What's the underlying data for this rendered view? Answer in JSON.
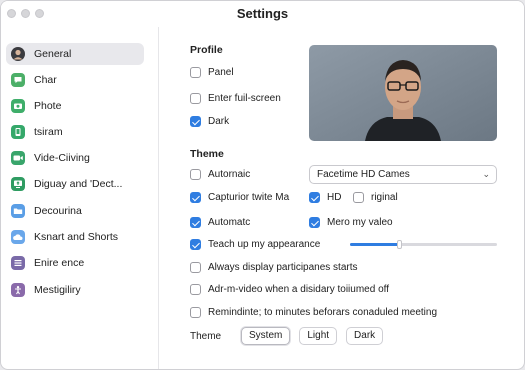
{
  "window": {
    "title": "Settings"
  },
  "sidebar": {
    "items": [
      {
        "label": "General",
        "icon": "avatar-icon",
        "color": "#ffffff"
      },
      {
        "label": "Char",
        "icon": "chat-icon",
        "color": "#4caf68"
      },
      {
        "label": "Phote",
        "icon": "camera-icon",
        "color": "#3fae6a"
      },
      {
        "label": "tsiram",
        "icon": "phone-icon",
        "color": "#35a86a"
      },
      {
        "label": "Vide-Ciiving",
        "icon": "video-icon",
        "color": "#39a56b"
      },
      {
        "label": "Diguay and 'Dect...",
        "icon": "share-screen-icon",
        "color": "#2f9c62"
      },
      {
        "label": "Decourina",
        "icon": "folder-icon",
        "color": "#5a9ee6"
      },
      {
        "label": "Ksnart and Shorts",
        "icon": "cloud-icon",
        "color": "#6aa7ea"
      },
      {
        "label": "Enire ence",
        "icon": "list-icon",
        "color": "#7a6aa8"
      },
      {
        "label": "Mestigiliry",
        "icon": "accessibility-icon",
        "color": "#8a6aaa"
      }
    ]
  },
  "profile": {
    "heading": "Profile",
    "options": [
      {
        "label": "Panel",
        "checked": false
      },
      {
        "label": "Enter fuil-screen",
        "checked": false
      },
      {
        "label": "Dark",
        "checked": true
      }
    ]
  },
  "theme": {
    "heading": "Theme",
    "camera_select": "Facetime HD Cames",
    "options": [
      {
        "label": "Autornaic",
        "checked": false
      },
      {
        "label": "Capturior twite Ma",
        "checked": true
      },
      {
        "label": "Automatc",
        "checked": true
      },
      {
        "label": "Teach up my appearance",
        "checked": true
      },
      {
        "label": "Always display participanes starts",
        "checked": false
      },
      {
        "label": "Adr-m-video when a disidary toiiumed off",
        "checked": false
      },
      {
        "label": "Remindinte; to minutes beforars conaduled meeting",
        "checked": false
      }
    ],
    "hd": {
      "label": "HD",
      "checked": true
    },
    "original": {
      "label": "riginal",
      "checked": false
    },
    "mirror": {
      "label": "Mero my valeo",
      "checked": true
    },
    "touchup_level": 0.33
  },
  "theme_row": {
    "label": "Theme",
    "choices": [
      "System",
      "Light",
      "Dark"
    ],
    "selected": "System"
  },
  "colors": {
    "accent": "#2f7de1"
  }
}
